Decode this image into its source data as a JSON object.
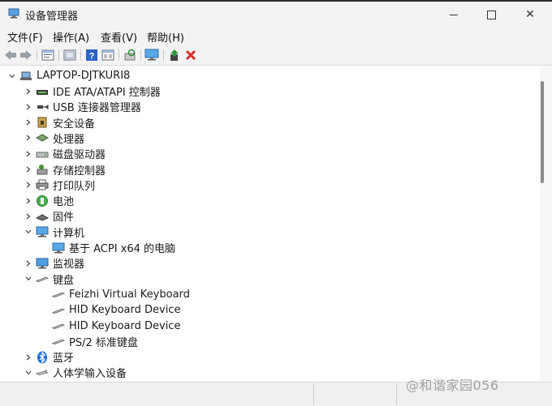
{
  "window": {
    "title": "设备管理器",
    "min_icon": "minimize-icon",
    "max_icon": "maximize-icon",
    "close_glyph": "✕"
  },
  "menu": [
    "文件(F)",
    "操作(A)",
    "查看(V)",
    "帮助(H)"
  ],
  "toolbar_icons": [
    "back-arrow-icon",
    "forward-arrow-icon",
    "properties-icon",
    "show-hide-tree-icon",
    "help-icon",
    "view-resources-icon",
    "scan-hardware-icon",
    "monitor-icon",
    "update-driver-icon",
    "uninstall-icon"
  ],
  "tree": {
    "root": "LAPTOP-DJTKURI8",
    "items": [
      {
        "label": "IDE ATA/ATAPI 控制器",
        "icon": "ide-controller-icon",
        "expanded": false
      },
      {
        "label": "USB 连接器管理器",
        "icon": "usb-icon",
        "expanded": false
      },
      {
        "label": "安全设备",
        "icon": "security-device-icon",
        "expanded": false
      },
      {
        "label": "处理器",
        "icon": "processor-icon",
        "expanded": false
      },
      {
        "label": "磁盘驱动器",
        "icon": "disk-drive-icon",
        "expanded": false
      },
      {
        "label": "存储控制器",
        "icon": "storage-controller-icon",
        "expanded": false
      },
      {
        "label": "打印队列",
        "icon": "printer-icon",
        "expanded": false
      },
      {
        "label": "电池",
        "icon": "battery-icon",
        "expanded": false
      },
      {
        "label": "固件",
        "icon": "firmware-icon",
        "expanded": false
      },
      {
        "label": "计算机",
        "icon": "computer-icon",
        "expanded": true
      },
      {
        "label": "基于 ACPI x64 的电脑",
        "icon": "computer-icon",
        "child": true
      },
      {
        "label": "监视器",
        "icon": "monitor-icon",
        "expanded": false
      },
      {
        "label": "键盘",
        "icon": "keyboard-icon",
        "expanded": true
      },
      {
        "label": "Feizhi Virtual Keyboard",
        "icon": "keyboard-icon",
        "child": true
      },
      {
        "label": "HID Keyboard Device",
        "icon": "keyboard-icon",
        "child": true
      },
      {
        "label": "HID Keyboard Device",
        "icon": "keyboard-icon",
        "child": true
      },
      {
        "label": "PS/2 标准键盘",
        "icon": "keyboard-icon",
        "child": true
      },
      {
        "label": "蓝牙",
        "icon": "bluetooth-icon",
        "expanded": false
      },
      {
        "label": "人体学输入设备",
        "icon": "hid-icon",
        "expanded": true
      }
    ]
  },
  "watermark": "@和谐家园056",
  "colors": {
    "chrome": "#f3f3f3",
    "accent": "#0078d4",
    "uninstall_red": "#d32f2f"
  }
}
